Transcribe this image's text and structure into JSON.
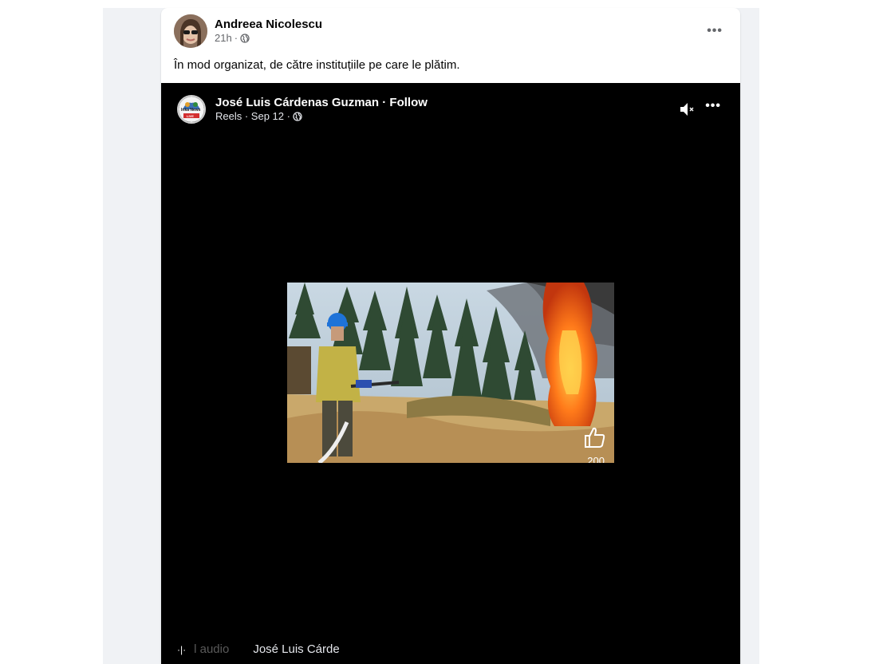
{
  "post": {
    "author": "Andreea Nicolescu",
    "time": "21h",
    "separator": "·",
    "text": "În mod organizat, de către instituțiile pe care le plătim.",
    "more_icon": "more-horizontal-icon"
  },
  "shared": {
    "author": "José Luis Cárdenas Guzman",
    "follow": "Follow",
    "meta": "Reels · Sep 12 ·",
    "avatar_text": "Inka News",
    "avatar_badge": "LIVE",
    "mute_icon": "speaker-muted-icon",
    "more_icon": "more-horizontal-icon"
  },
  "video": {
    "like_icon": "thumbs-up-icon",
    "like_count": "200",
    "audio_icon": "audio-wave-icon",
    "audio_label": "l audio",
    "audio_artist": "José Luis Cárde"
  },
  "colors": {
    "feed_bg": "#f0f2f5",
    "card_bg": "#ffffff",
    "video_bg": "#000000",
    "text_primary": "#050505",
    "text_secondary": "#65676b"
  }
}
